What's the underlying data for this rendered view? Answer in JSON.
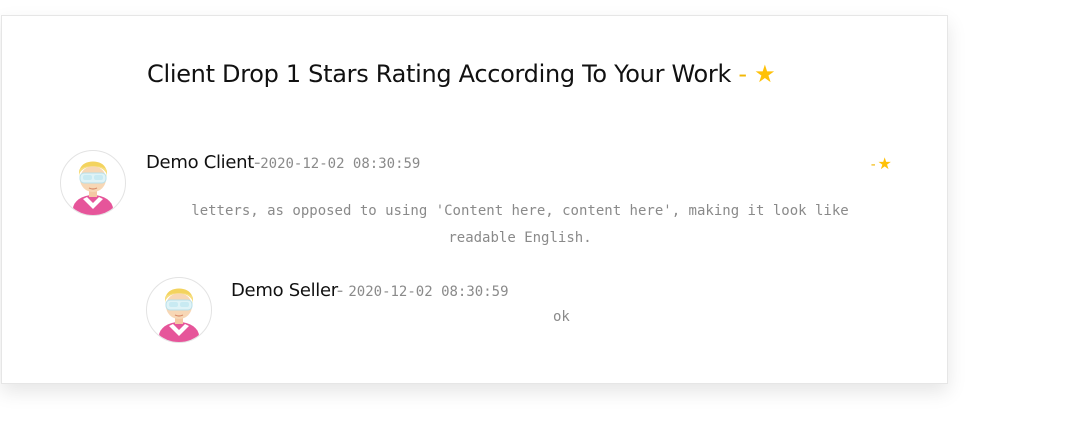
{
  "review": {
    "title": "Client Drop 1 Stars Rating According To Your Work",
    "title_separator": "-",
    "rating_value": 1,
    "rating_max": 1,
    "accent_color": "#ffc107"
  },
  "client_comment": {
    "author": "Demo Client",
    "separator": "-",
    "date": "2020-12-02 08:30:59",
    "rating_separator": "-",
    "rating_value": 1,
    "text": "letters, as opposed to using 'Content here, content here', making it look like readable English.",
    "avatar_icon": "user-avatar-icon"
  },
  "seller_reply": {
    "author": "Demo Seller",
    "separator": "-",
    "date": "2020-12-02 08:30:59",
    "text": "ok",
    "avatar_icon": "user-avatar-icon"
  }
}
